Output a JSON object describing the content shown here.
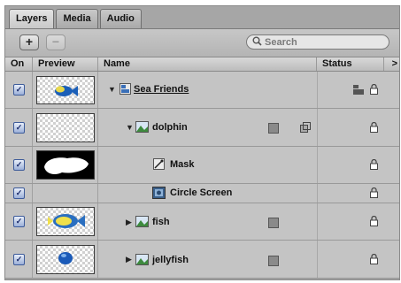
{
  "tabs": [
    {
      "label": "Layers"
    },
    {
      "label": "Media"
    },
    {
      "label": "Audio"
    }
  ],
  "toolbar": {
    "add_label": "+",
    "remove_label": "−",
    "search_placeholder": "Search"
  },
  "columns": {
    "on": "On",
    "preview": "Preview",
    "name": "Name",
    "status": "Status",
    "more": ">"
  },
  "rows": [
    {
      "name": "Sea Friends",
      "checked": true,
      "expanded": true,
      "type": "group",
      "preview": "fish-thumb"
    },
    {
      "name": "dolphin",
      "checked": true,
      "expanded": true,
      "type": "layer",
      "preview": "empty-checker"
    },
    {
      "name": "Mask",
      "checked": true,
      "type": "mask",
      "preview": "white-shape"
    },
    {
      "name": "Circle Screen",
      "checked": true,
      "type": "filter",
      "preview": "none"
    },
    {
      "name": "fish",
      "checked": true,
      "expanded": false,
      "type": "layer",
      "preview": "fish-thumb"
    },
    {
      "name": "jellyfish",
      "checked": true,
      "expanded": false,
      "type": "layer",
      "preview": "jelly-thumb"
    }
  ],
  "checkmark": "✓",
  "icons": {
    "expanded_triangle": "▼",
    "collapsed_triangle": "▶",
    "search": "magnifier-icon"
  }
}
